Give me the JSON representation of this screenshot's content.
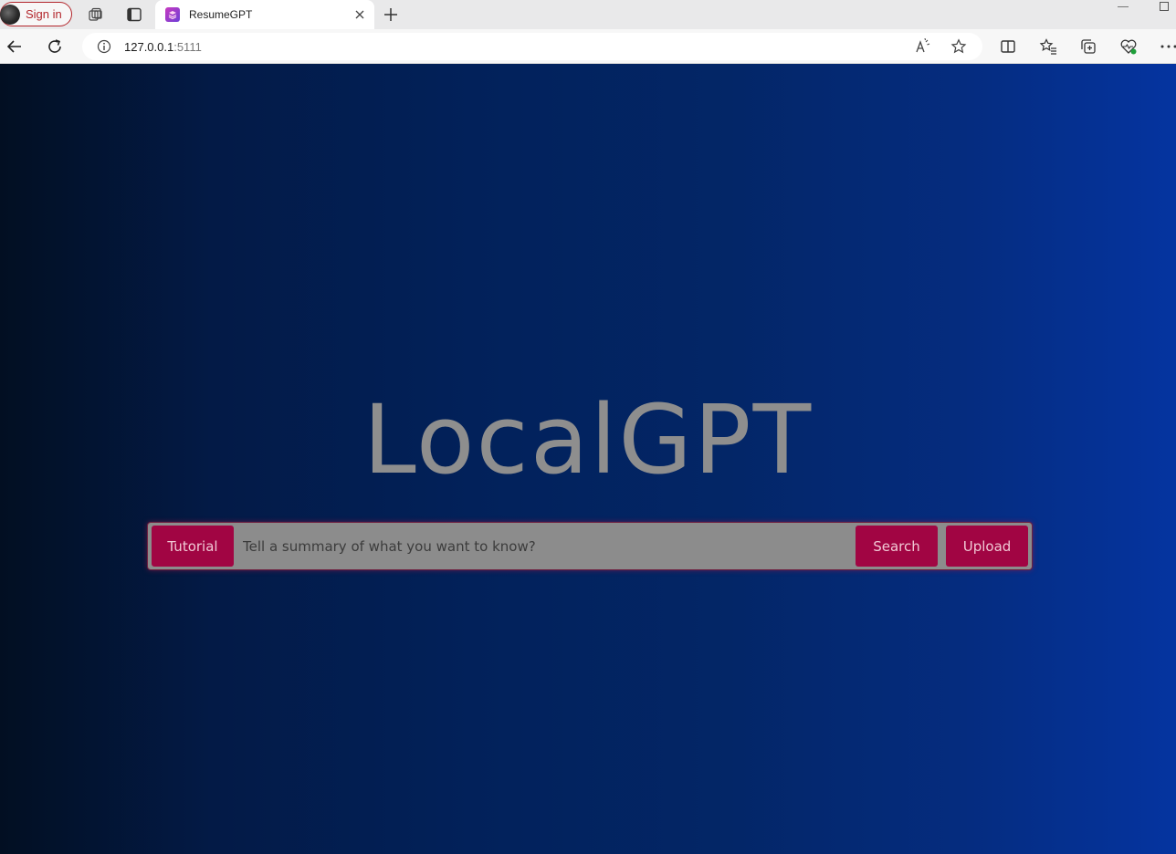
{
  "browser": {
    "signin_label": "Sign in",
    "tab": {
      "title": "ResumeGPT"
    },
    "address": {
      "host": "127.0.0.1",
      "port": ":5111"
    },
    "icons": [
      "workspaces-icon",
      "tab-actions-icon",
      "close-icon",
      "new-tab-icon",
      "back-icon",
      "refresh-icon",
      "site-info-icon",
      "read-aloud-icon",
      "favorite-star-icon",
      "split-screen-icon",
      "favorites-icon",
      "collections-icon",
      "browser-essentials-icon",
      "more-icon"
    ]
  },
  "page": {
    "brand": "LocalGPT",
    "tutorial_button": "Tutorial",
    "search_placeholder": "Tell a summary of what you want to know?",
    "search_button": "Search",
    "upload_button": "Upload",
    "colors": {
      "button_bg": "#a10543",
      "bar_bg": "#8c8c8c",
      "brand_text": "#8e8e8e",
      "gradient_left": "#020f22",
      "gradient_right": "#0534a0"
    }
  }
}
